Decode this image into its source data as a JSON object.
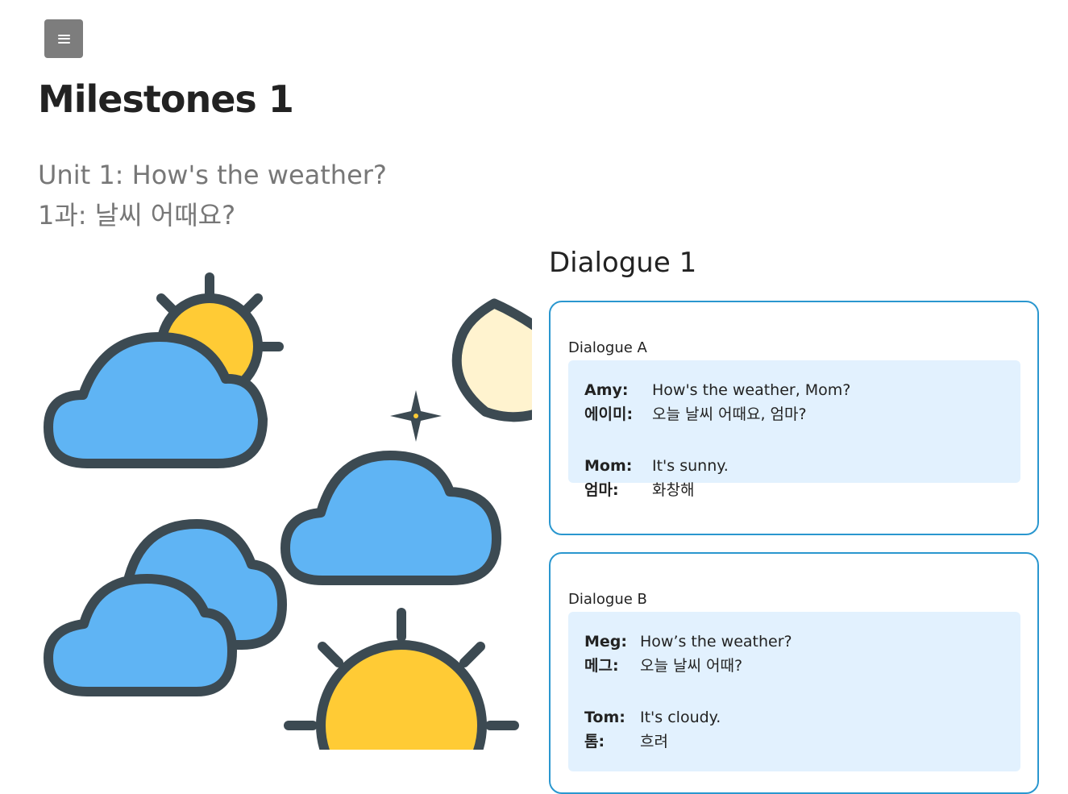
{
  "menu": {
    "icon": "hamburger-menu-icon"
  },
  "page": {
    "title": "Milestones 1",
    "subtitle_en": "Unit 1: How's the weather?",
    "subtitle_ko": "1과: 날씨 어때요?"
  },
  "illustration": {
    "icons": [
      "partly-sunny-cloud-icon",
      "night-cloud-moon-icon",
      "cloudy-icon",
      "sun-icon"
    ],
    "colors": {
      "cloud": "#5fb4f4",
      "sun": "#ffcb35",
      "moon": "#fff3cf",
      "outline": "#3c4a52"
    }
  },
  "dialogue": {
    "heading": "Dialogue 1",
    "accent_color": "#2a97cf",
    "box_color": "#e2f1fe",
    "a": {
      "label": "Dialogue A",
      "lines": [
        {
          "speaker": "Amy:",
          "text": "How's the weather, Mom?"
        },
        {
          "speaker": "에이미:",
          "text": "오늘 날씨 어때요, 엄마?"
        },
        {
          "speaker": "Mom:",
          "text": "It's sunny."
        },
        {
          "speaker": "엄마:",
          "text": "화창해"
        }
      ]
    },
    "b": {
      "label": "Dialogue B",
      "lines": [
        {
          "speaker": "Meg:",
          "text": "How’s the weather?"
        },
        {
          "speaker": "메그:",
          "text": "오늘 날씨 어때?"
        },
        {
          "speaker": "Tom:",
          "text": "It's cloudy."
        },
        {
          "speaker": "톰:",
          "text": "흐려"
        }
      ]
    }
  }
}
